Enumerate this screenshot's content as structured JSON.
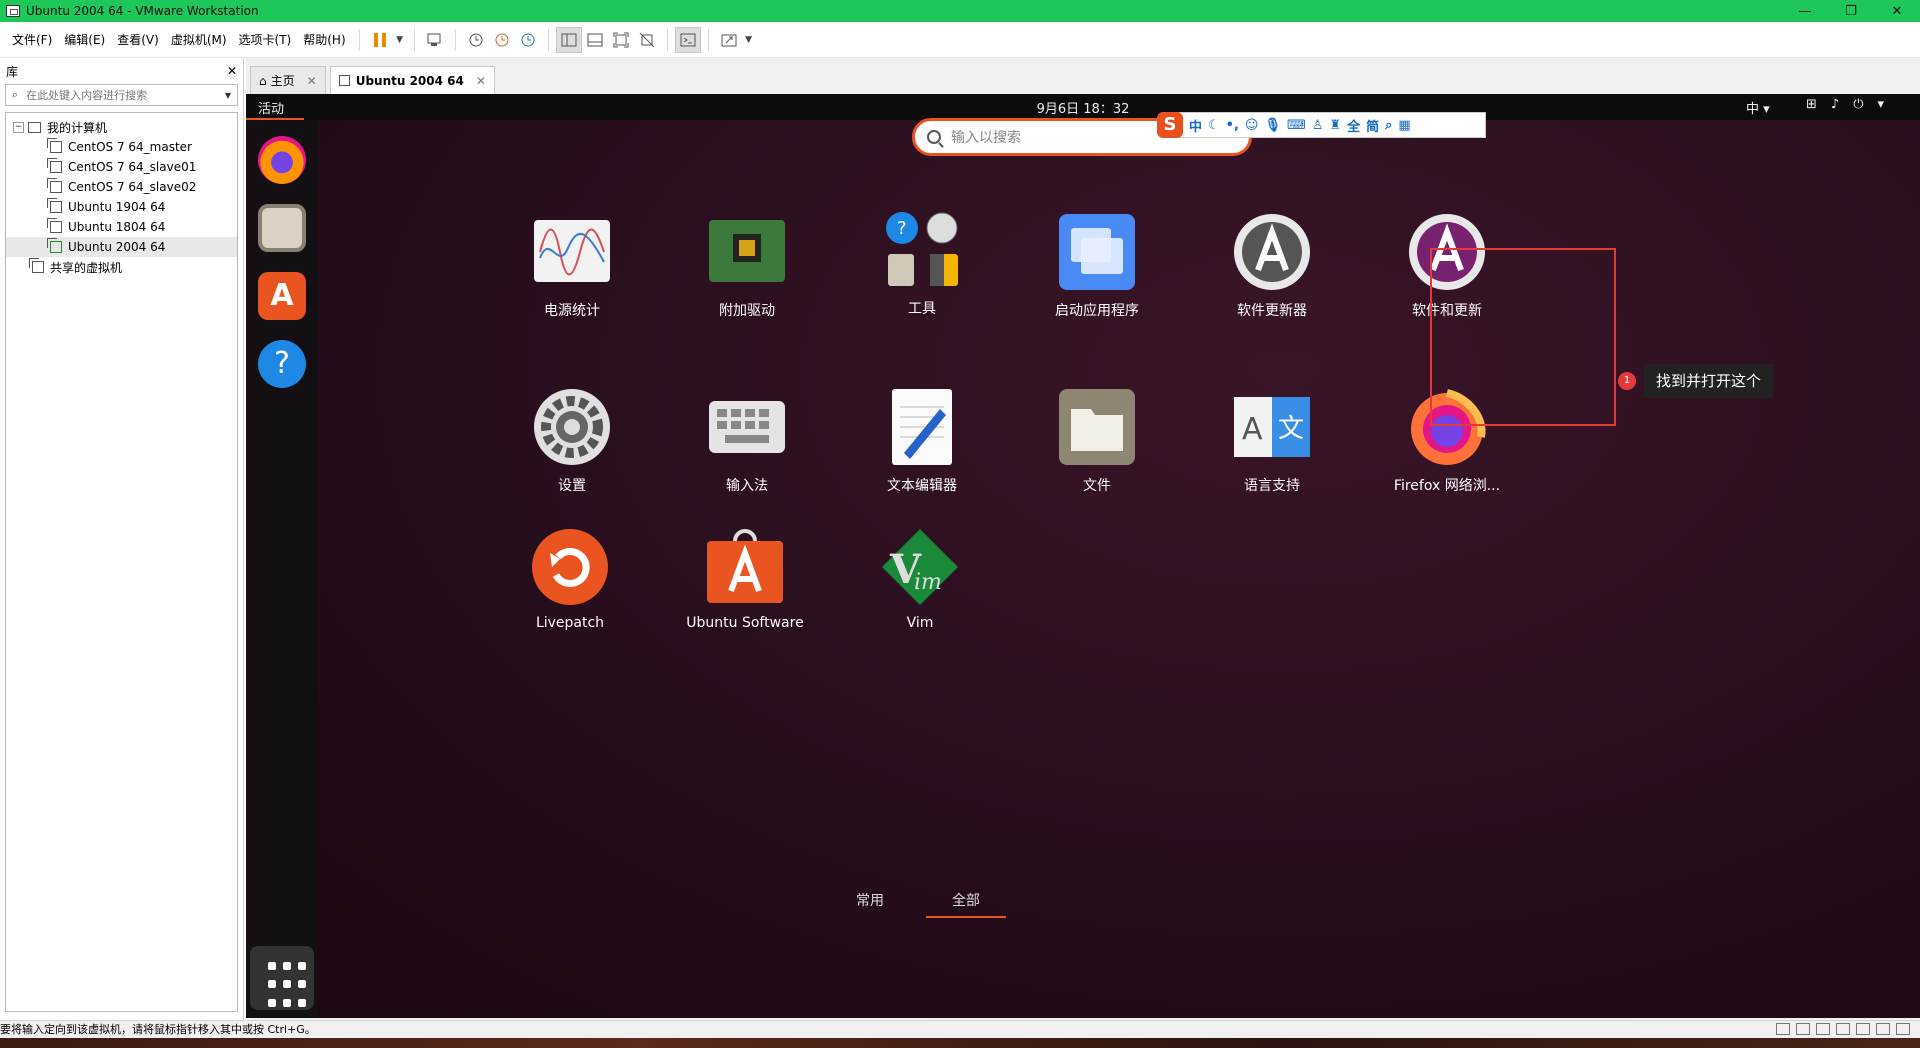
{
  "window": {
    "title": "Ubuntu 2004 64 - VMware Workstation",
    "min": "—",
    "max": "❐",
    "close": "✕"
  },
  "menu": [
    "文件(F)",
    "编辑(E)",
    "查看(V)",
    "虚拟机(M)",
    "选项卡(T)",
    "帮助(H)"
  ],
  "library": {
    "title": "库",
    "close": "✕",
    "search_placeholder": "在此处键入内容进行搜索",
    "root": "我的计算机",
    "vms": [
      "CentOS 7 64_master",
      "CentOS 7 64_slave01",
      "CentOS 7 64_slave02",
      "Ubuntu 1904 64",
      "Ubuntu 1804 64",
      "Ubuntu 2004 64"
    ],
    "shared": "共享的虚拟机"
  },
  "tabs": [
    {
      "label": "主页"
    },
    {
      "label": "Ubuntu 2004 64"
    }
  ],
  "guest": {
    "activities": "活动",
    "clock": "9月6日  18：32",
    "ime_indicator": "中 ▾",
    "search_placeholder": "输入以搜索",
    "ime_glyphs": [
      "中",
      "全",
      "简"
    ],
    "apps": [
      {
        "label": "电源统计"
      },
      {
        "label": "附加驱动"
      },
      {
        "label": "工具"
      },
      {
        "label": "启动应用程序"
      },
      {
        "label": "软件更新器"
      },
      {
        "label": "软件和更新"
      },
      {
        "label": "设置"
      },
      {
        "label": "输入法"
      },
      {
        "label": "文本编辑器"
      },
      {
        "label": "文件"
      },
      {
        "label": "语言支持"
      },
      {
        "label": "Firefox 网络浏..."
      },
      {
        "label": "Livepatch"
      },
      {
        "label": "Ubuntu Software"
      },
      {
        "label": "Vim"
      }
    ],
    "annotation": {
      "badge": "1",
      "text": "找到并打开这个"
    },
    "bottom_tabs": [
      "常用",
      "全部"
    ]
  },
  "status": {
    "text": "要将输入定向到该虚拟机，请将鼠标指针移入其中或按 Ctrl+G。"
  },
  "colors": {
    "ubuntu_orange": "#e95420",
    "titlebar_green": "#1dc75a",
    "highlight_red": "#e23a3a"
  }
}
